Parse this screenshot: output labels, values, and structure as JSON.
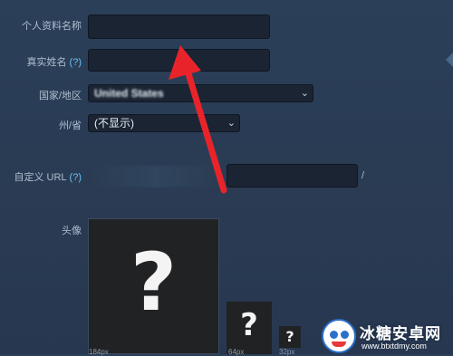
{
  "form": {
    "profile_name_label": "个人资料名称",
    "real_name_label": "真实姓名",
    "real_name_help": "(?)",
    "country_label": "国家/地区",
    "country_value": "United States",
    "state_label": "州/省",
    "state_value": "(不显示)",
    "custom_url_label": "自定义 URL",
    "custom_url_help": "(?)",
    "custom_url_suffix": "/",
    "avatar_label": "头像"
  },
  "avatar": {
    "placeholder_glyph": "?",
    "sizes": [
      "184px",
      "64px",
      "32px"
    ]
  },
  "watermark": {
    "title": "冰糖安卓网",
    "url": "www.btxtdmy.com"
  },
  "colors": {
    "accent_link": "#66c0f4",
    "annotation_arrow": "#e8242a",
    "background": "#2a3b53"
  }
}
